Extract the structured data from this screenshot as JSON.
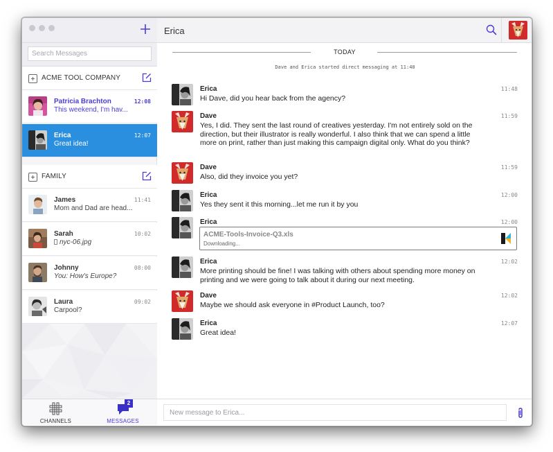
{
  "sidebar": {
    "search_placeholder": "Search Messages",
    "groups": [
      {
        "title": "ACME TOOL COMPANY",
        "conversations": [
          {
            "name": "Patricia Brachton",
            "preview": "This weekend, I'm hav...",
            "time": "12:08",
            "state": "unread"
          },
          {
            "name": "Erica",
            "preview": "Great idea!",
            "time": "12:07",
            "state": "active"
          }
        ]
      },
      {
        "title": "FAMILY",
        "conversations": [
          {
            "name": "James",
            "preview": "Mom and Dad are head...",
            "time": "11:41"
          },
          {
            "name": "Sarah",
            "preview": "nyc-06.jpg",
            "time": "10:02"
          },
          {
            "name": "Johnny",
            "preview": "You: How's Europe?",
            "time": "08:00"
          },
          {
            "name": "Laura",
            "preview": "Carpool?",
            "time": "09:02"
          }
        ]
      }
    ],
    "nav": {
      "channels_label": "CHANNELS",
      "messages_label": "MESSAGES",
      "messages_badge": "2"
    }
  },
  "main": {
    "title": "Erica",
    "today_label": "TODAY",
    "system_message": "Dave and Erica started direct messaging at 11:40",
    "messages": [
      {
        "author": "Erica",
        "time": "11:48",
        "text": "Hi Dave, did you hear back from the agency?"
      },
      {
        "author": "Dave",
        "time": "11:59",
        "text": "Yes, I did. They sent the last round of creatives yesterday. I'm not entirely sold on the direction, but their illustrator is really wonderful. I also think that we can spend a little more on print, rather than just making this campaign digital only. What do you think?"
      },
      {
        "author": "Dave",
        "time": "11:59",
        "text": "Also, did they invoice you yet?"
      },
      {
        "author": "Erica",
        "time": "12:00",
        "text": "Yes they sent it this morning...let me run it by you"
      },
      {
        "author": "Erica",
        "time": "12:00",
        "file_name": "ACME-Tools-Invoice-Q3.xls",
        "file_status": "Downloading..."
      },
      {
        "author": "Erica",
        "time": "12:02",
        "text": "More printing should be fine! I was talking with others about spending more money on printing and we were going to talk about it during our next meeting."
      },
      {
        "author": "Dave",
        "time": "12:02",
        "text": "Maybe we should ask everyone in #Product Launch, too?"
      },
      {
        "author": "Erica",
        "time": "12:07",
        "text": "Great idea!"
      }
    ],
    "composer_placeholder": "New message to Erica..."
  },
  "colors": {
    "accent": "#4a3bd6",
    "active_row": "#2b8fe0",
    "badge": "#3a2fc7"
  },
  "icons": {
    "new_conversation": "plus-icon",
    "compose": "compose-icon",
    "search": "search-icon",
    "channels": "channels-grid-icon",
    "messages": "chat-bubble-icon",
    "attachment": "paperclip-icon",
    "file_type": "kite-file-icon"
  }
}
